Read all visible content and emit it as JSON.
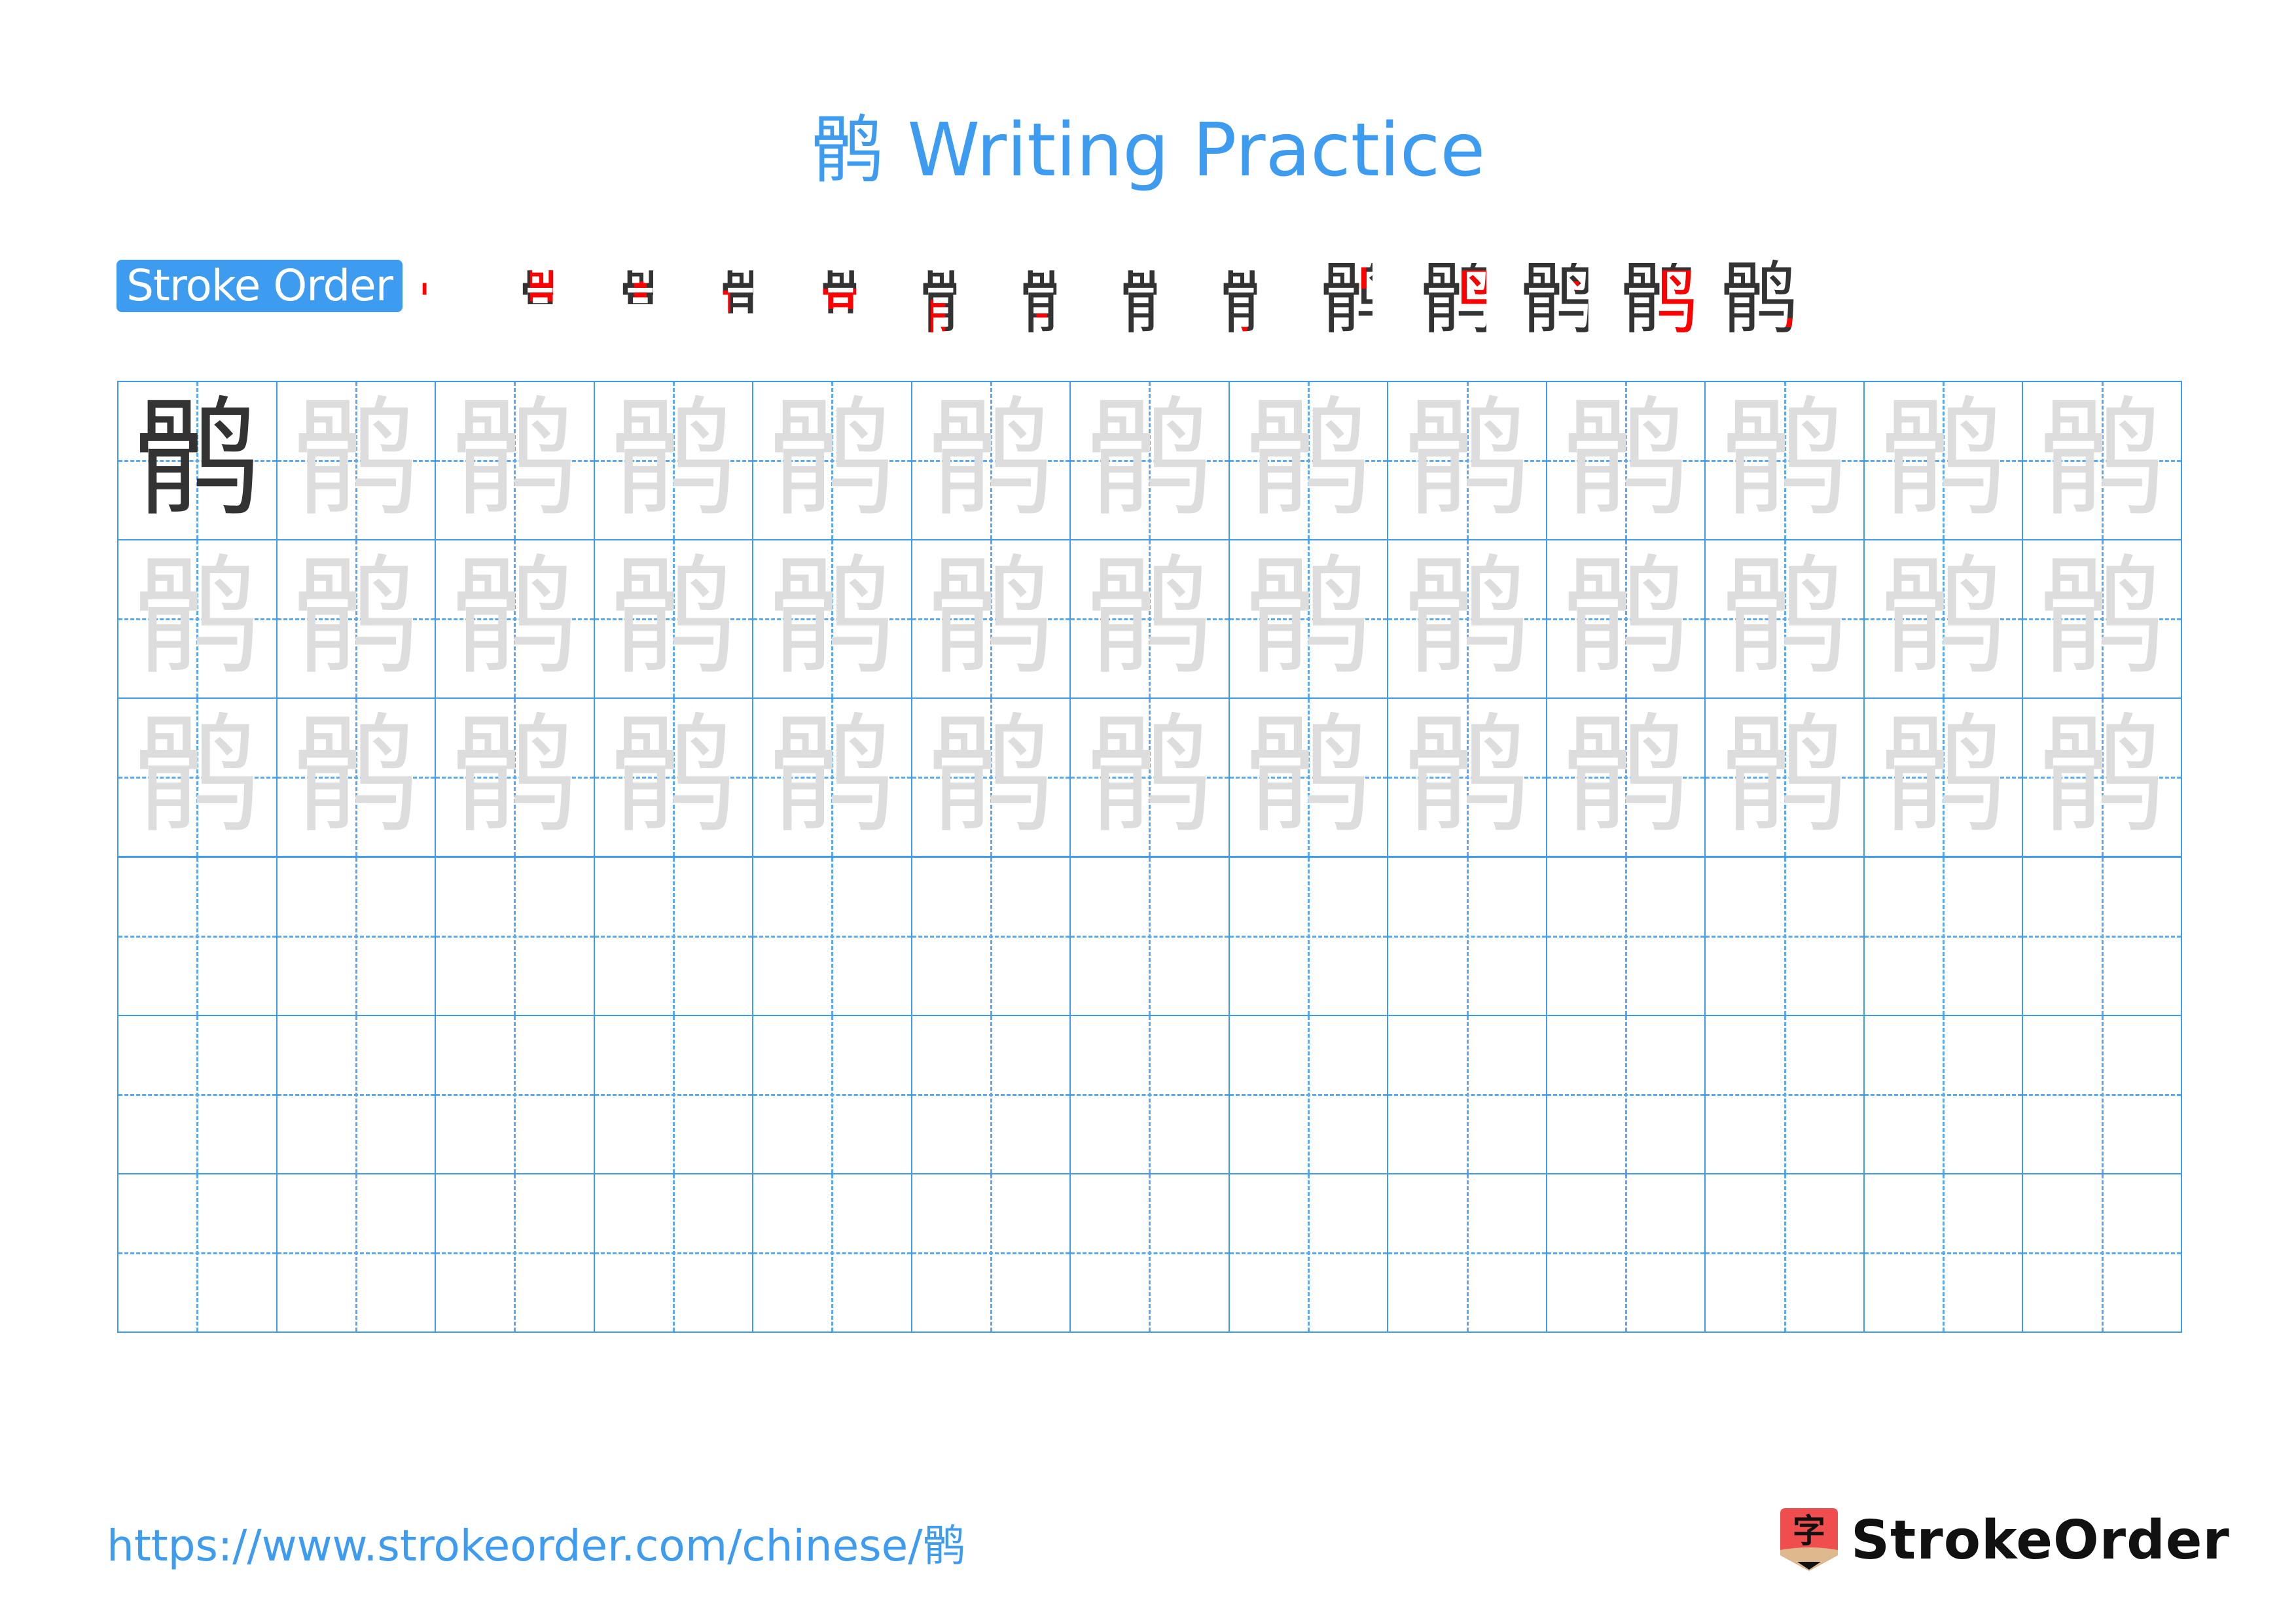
{
  "header": {
    "title": "鹘 Writing Practice"
  },
  "character": "鹘",
  "stroke_order": {
    "label": "Stroke Order",
    "total_strokes": 14,
    "steps": [
      1,
      2,
      3,
      4,
      5,
      6,
      7,
      8,
      9,
      10,
      11,
      12,
      13,
      14
    ]
  },
  "grid": {
    "rows": 6,
    "columns": 13,
    "filled_rows": 3,
    "model_cell": {
      "row": 1,
      "column": 1
    },
    "line_color": "#3d9bf0"
  },
  "colors": {
    "accent": "#3d9bf0",
    "model_char": "#333333",
    "trace_char": "#dddddd",
    "stroke_highlight": "#ff0000"
  },
  "footer": {
    "url": "https://www.strokeorder.com/chinese/鹘",
    "brand": "StrokeOrder",
    "logo_glyph": "字"
  }
}
